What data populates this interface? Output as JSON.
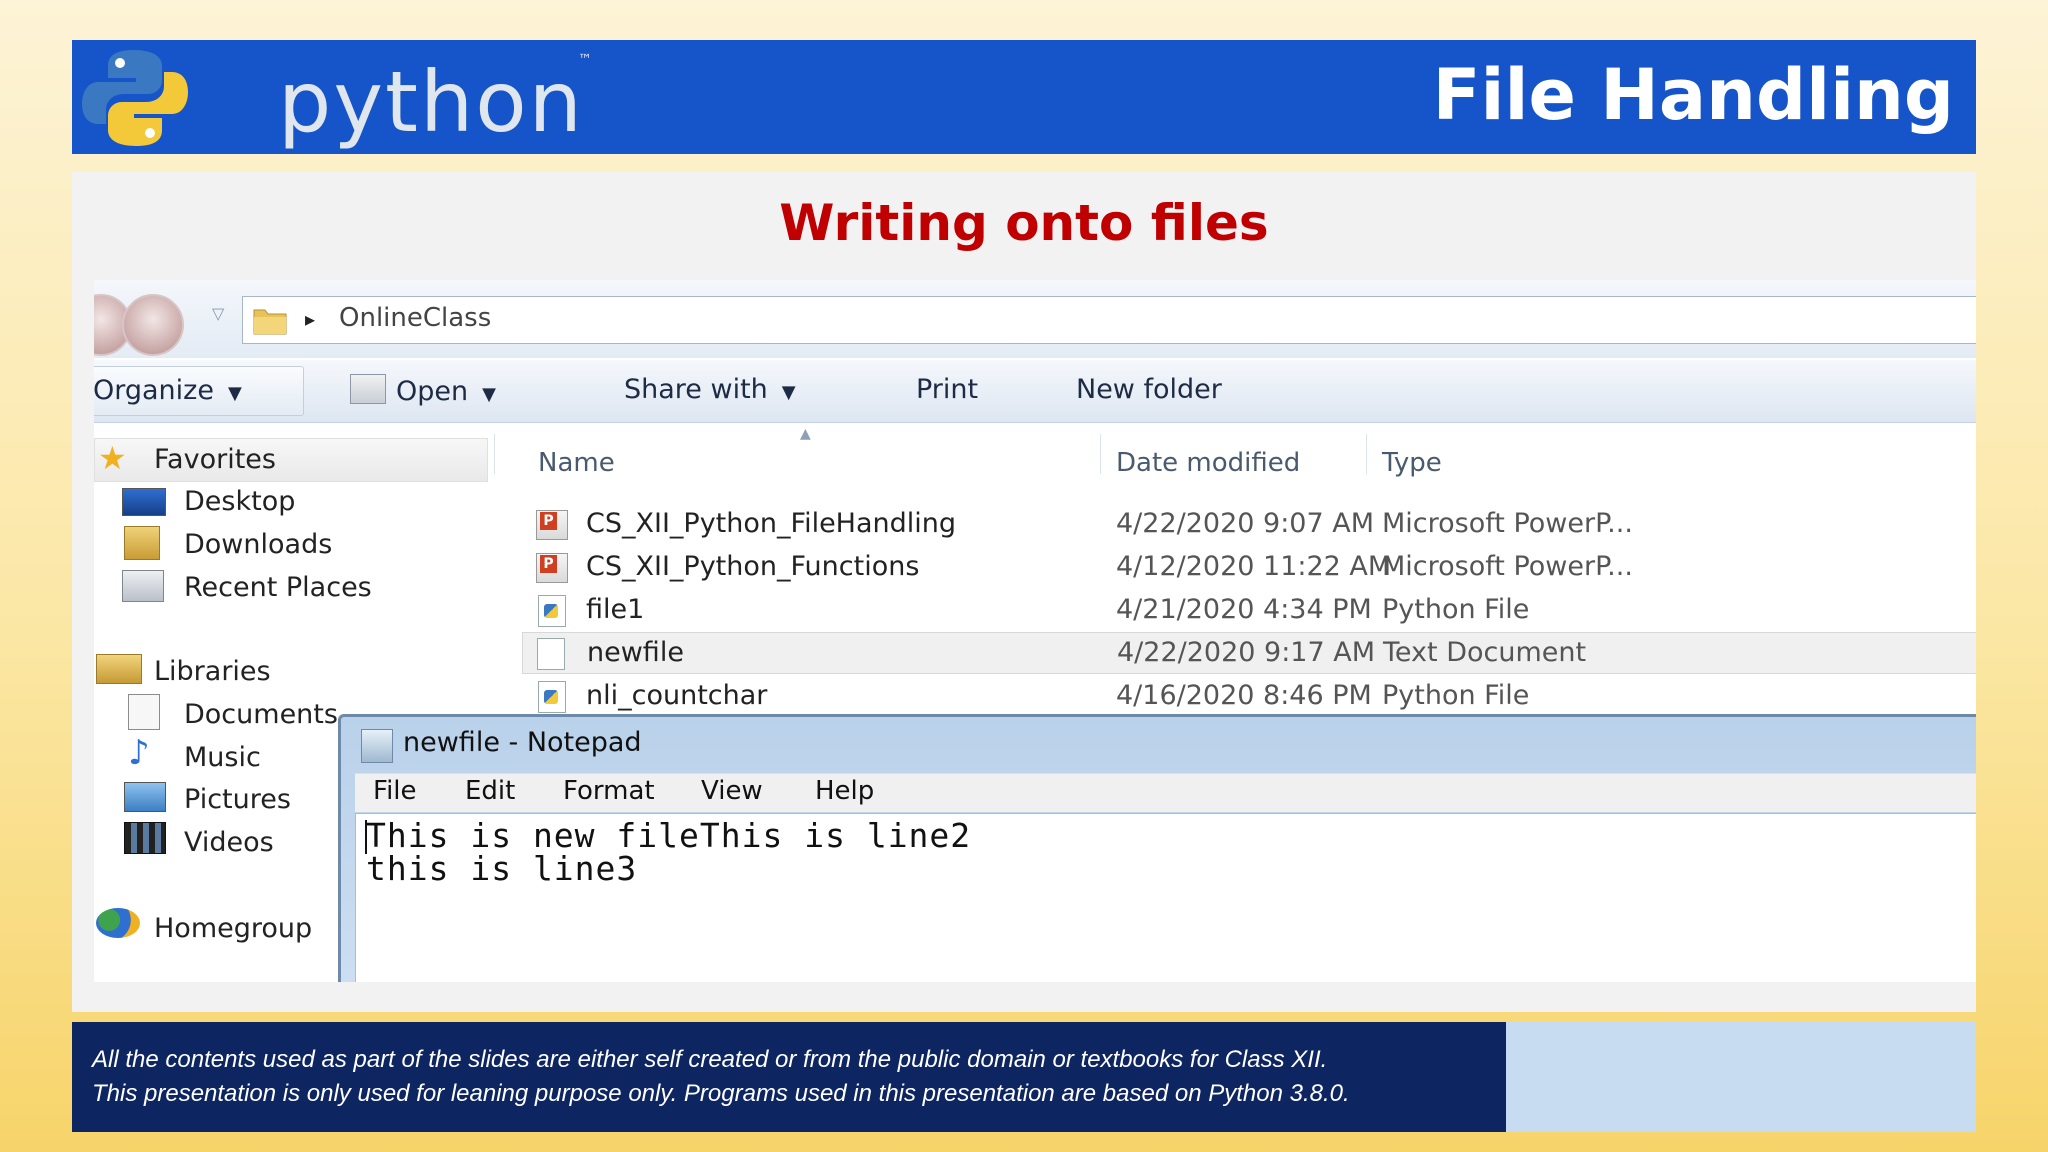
{
  "header": {
    "logo_text": "python",
    "logo_tm": "™",
    "title": "File Handling"
  },
  "section_title": "Writing onto files",
  "explorer": {
    "breadcrumb": "OnlineClass",
    "toolbar": {
      "organize": "Organize",
      "open": "Open",
      "share_with": "Share with",
      "print": "Print",
      "new_folder": "New folder"
    },
    "nav": {
      "favorites": "Favorites",
      "desktop": "Desktop",
      "downloads": "Downloads",
      "recent_places": "Recent Places",
      "libraries": "Libraries",
      "documents": "Documents",
      "music": "Music",
      "pictures": "Pictures",
      "videos": "Videos",
      "homegroup": "Homegroup"
    },
    "columns": {
      "name": "Name",
      "date_modified": "Date modified",
      "type": "Type"
    },
    "files": [
      {
        "name": "CS_XII_Python_FileHandling",
        "date": "4/22/2020 9:07 AM",
        "type": "Microsoft PowerP...",
        "icon": "powerpoint-icon"
      },
      {
        "name": "CS_XII_Python_Functions",
        "date": "4/12/2020 11:22 AM",
        "type": "Microsoft PowerP...",
        "icon": "powerpoint-icon"
      },
      {
        "name": "file1",
        "date": "4/21/2020 4:34 PM",
        "type": "Python File",
        "icon": "python-file-icon"
      },
      {
        "name": "newfile",
        "date": "4/22/2020 9:17 AM",
        "type": "Text Document",
        "icon": "text-file-icon"
      },
      {
        "name": "nli_countchar",
        "date": "4/16/2020 8:46 PM",
        "type": "Python File",
        "icon": "python-file-icon"
      }
    ]
  },
  "notepad": {
    "title": "newfile - Notepad",
    "menu": {
      "file": "File",
      "edit": "Edit",
      "format": "Format",
      "view": "View",
      "help": "Help"
    },
    "lines": [
      "This is new fileThis is line2",
      "this is line3"
    ]
  },
  "footer": {
    "line1": "All the contents used as part of the slides are either self created or from the public domain  or textbooks for Class XII.",
    "line2": " This presentation is only used for leaning purpose  only.  Programs used in this presentation are based on Python 3.8.0."
  },
  "colors": {
    "banner_blue": "#1654c9",
    "section_title_red": "#c00000",
    "footer_navy": "#0d2560",
    "footer_right": "#c7dcf1"
  }
}
